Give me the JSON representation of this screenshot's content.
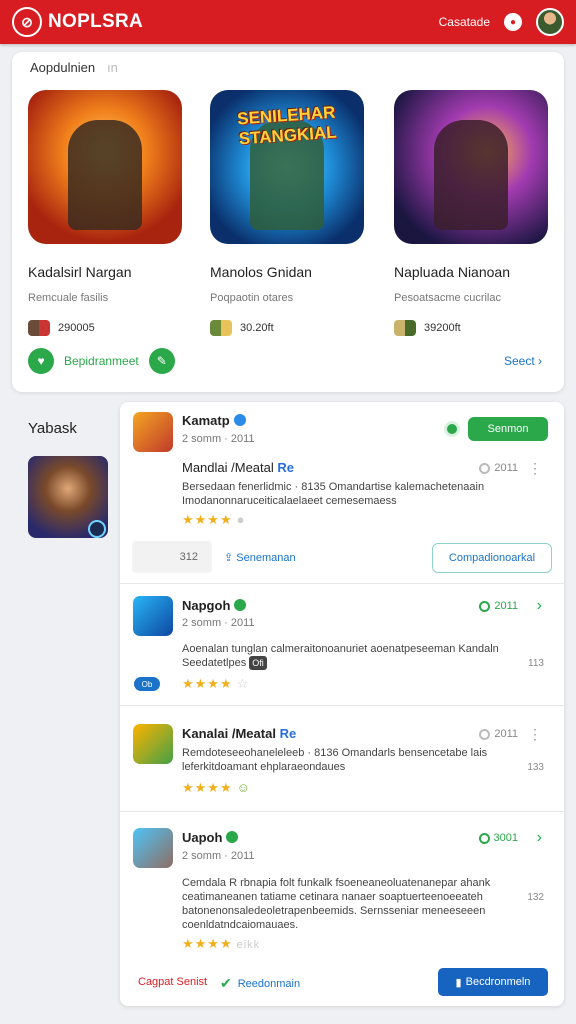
{
  "header": {
    "brand": "NOPLSRA",
    "link": "Casatade",
    "colors": {
      "bar": "#d81d22"
    }
  },
  "featured": {
    "title": "Aopdulnien",
    "title_suffix": "ın",
    "games": [
      {
        "name": "Kadalsirl Nargan",
        "sub": "Remcuale fasilis",
        "count": "290005",
        "banner": ""
      },
      {
        "name": "Manolos Gnidan",
        "sub": "Poqpaotin otares",
        "count": "30.20ft",
        "banner": "SENILEHAR STANGKIAL"
      },
      {
        "name": "Napluada Nianoan",
        "sub": "Pesoatsacme cucrilac",
        "count": "39200ft",
        "banner": ""
      }
    ],
    "action_label": "Bepidranmeet",
    "see_label": "Seect"
  },
  "side": {
    "title": "Yabask"
  },
  "reviews": [
    {
      "name": "Kamatp",
      "date": "2 somm · 2011",
      "follow": "Senmon",
      "headline": "Mandlai /Meatal",
      "headline_tag": "Re",
      "headline_date": "2011",
      "text": "Bersedaan fenerlidmic · 8135 Omandartise kalemachetenaain Imodanonnaruceiticalaelaeet cemesemaess",
      "stars": "★★★★",
      "count": "312",
      "share": "Senemanan",
      "outline": "Compadionoarkal"
    },
    {
      "name": "Napgoh",
      "date": "2 somm · 2011",
      "date_r": "2011",
      "text": "Aoenalan tunglan calmeraitonoanuriet aoenatpeseeman Kandaln Seedatetlpes",
      "tag": "Ofi",
      "stars": "★★★★",
      "count": "113",
      "badge": "Ob"
    },
    {
      "name": "Kanalai /Meatal",
      "name_tag": "Re",
      "date_r": "2011",
      "text": "Remdoteseeohaneleleeb · 8136 Omandarls bensencetabe lais leferkitdoamant ehplaraeondaues",
      "stars": "★★★★",
      "count": "133"
    },
    {
      "name": "Uapoh",
      "date": "2 somm · 2011",
      "date_r": "3001",
      "text": "Cemdala R rbnapia folt funkalk fsoeneaneoluatenanepar ahank ceatimaneanen tatiame cetinara nanaer soaptuerteenoeeateh batonenonsaledeoletrapenbeemids. Sernsseniar meneeseeen coenldatndcaiomauaes.",
      "stars": "★★★★",
      "stars_extra": "eikk",
      "count": "132"
    }
  ],
  "footer": {
    "red": "Cagpat Senist",
    "teal": "Reedonmain",
    "button": "Becdronmeln"
  }
}
